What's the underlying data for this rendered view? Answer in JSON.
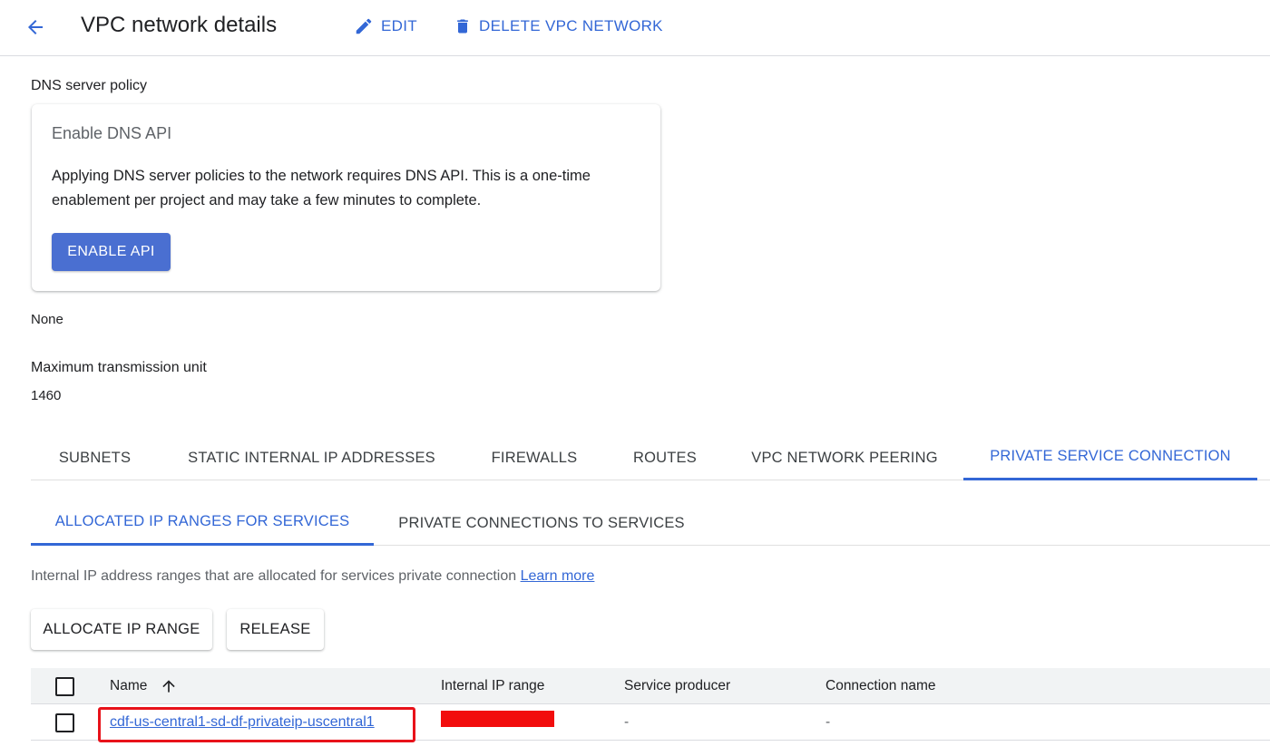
{
  "header": {
    "title": "VPC network details",
    "edit_label": "EDIT",
    "delete_label": "DELETE VPC NETWORK"
  },
  "dns": {
    "section_label": "DNS server policy",
    "card_title": "Enable DNS API",
    "card_description": "Applying DNS server policies to the network requires DNS API. This is a one-time enablement per project and may take a few minutes to complete.",
    "enable_button": "ENABLE API",
    "value": "None"
  },
  "mtu": {
    "label": "Maximum transmission unit",
    "value": "1460"
  },
  "main_tabs": [
    {
      "label": "SUBNETS",
      "active": false
    },
    {
      "label": "STATIC INTERNAL IP ADDRESSES",
      "active": false
    },
    {
      "label": "FIREWALLS",
      "active": false
    },
    {
      "label": "ROUTES",
      "active": false
    },
    {
      "label": "VPC NETWORK PEERING",
      "active": false
    },
    {
      "label": "PRIVATE SERVICE CONNECTION",
      "active": true
    }
  ],
  "sub_tabs": [
    {
      "label": "ALLOCATED IP RANGES FOR SERVICES",
      "active": true
    },
    {
      "label": "PRIVATE CONNECTIONS TO SERVICES",
      "active": false
    }
  ],
  "info": {
    "text": "Internal IP address ranges that are allocated for services private connection",
    "link": "Learn more"
  },
  "actions": {
    "allocate_label": "ALLOCATE IP RANGE",
    "release_label": "RELEASE"
  },
  "table": {
    "columns": [
      "Name",
      "Internal IP range",
      "Service producer",
      "Connection name"
    ],
    "rows": [
      {
        "name": "cdf-us-central1-sd-df-privateip-uscentral1",
        "service_producer": "-",
        "connection_name": "-"
      }
    ]
  },
  "colors": {
    "accent": "#3367d6",
    "primary_button": "#4a6fd1",
    "highlight": "#e8121a",
    "redaction": "#f20d0d"
  },
  "icons": {
    "back": "arrow-left-icon",
    "edit": "pencil-icon",
    "delete": "trash-icon",
    "sort": "arrow-up-icon"
  }
}
